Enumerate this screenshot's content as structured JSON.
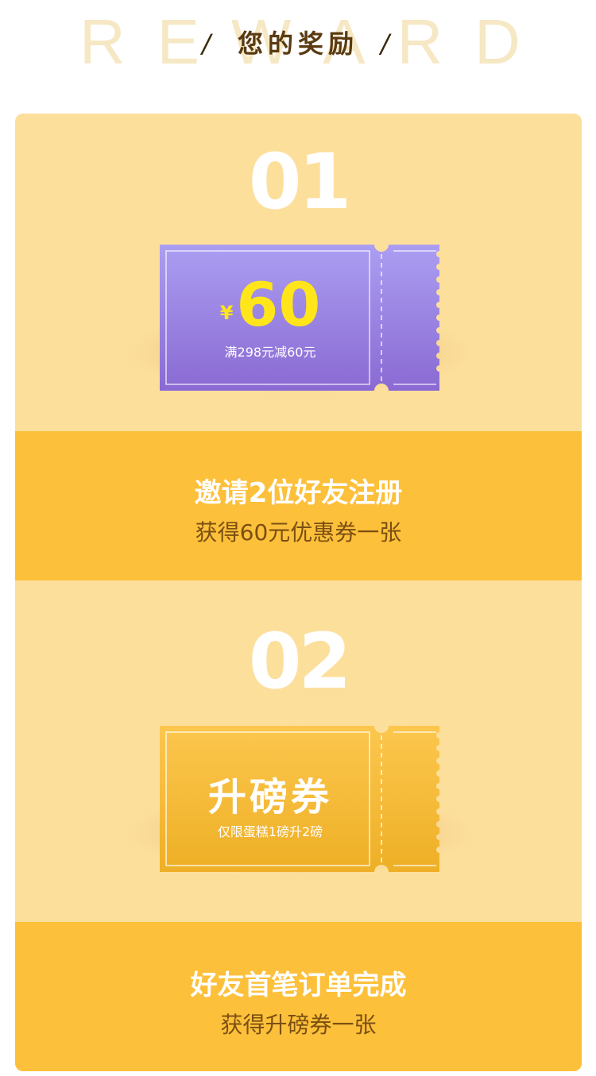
{
  "header": {
    "bg_letters": [
      "R",
      "E",
      "W",
      "A",
      "R",
      "D"
    ],
    "slash_left": "/",
    "title": "您的奖励",
    "slash_right": "/"
  },
  "rewards": [
    {
      "number": "01",
      "coupon": {
        "currency": "¥",
        "amount": "60",
        "condition": "满298元减60元"
      },
      "band_title": "邀请2位好友注册",
      "band_sub": "获得60元优惠券一张"
    },
    {
      "number": "02",
      "coupon": {
        "name": "升磅券",
        "condition": "仅限蛋糕1磅升2磅"
      },
      "band_title": "好友首笔订单完成",
      "band_sub": "获得升磅券一张"
    }
  ],
  "colors": {
    "card_bg": "#fddf9c",
    "band_bg": "#fdc03a",
    "coupon_purple": "#9d87e3",
    "coupon_gold": "#f8bd33",
    "price_yellow": "#ffe51a"
  }
}
